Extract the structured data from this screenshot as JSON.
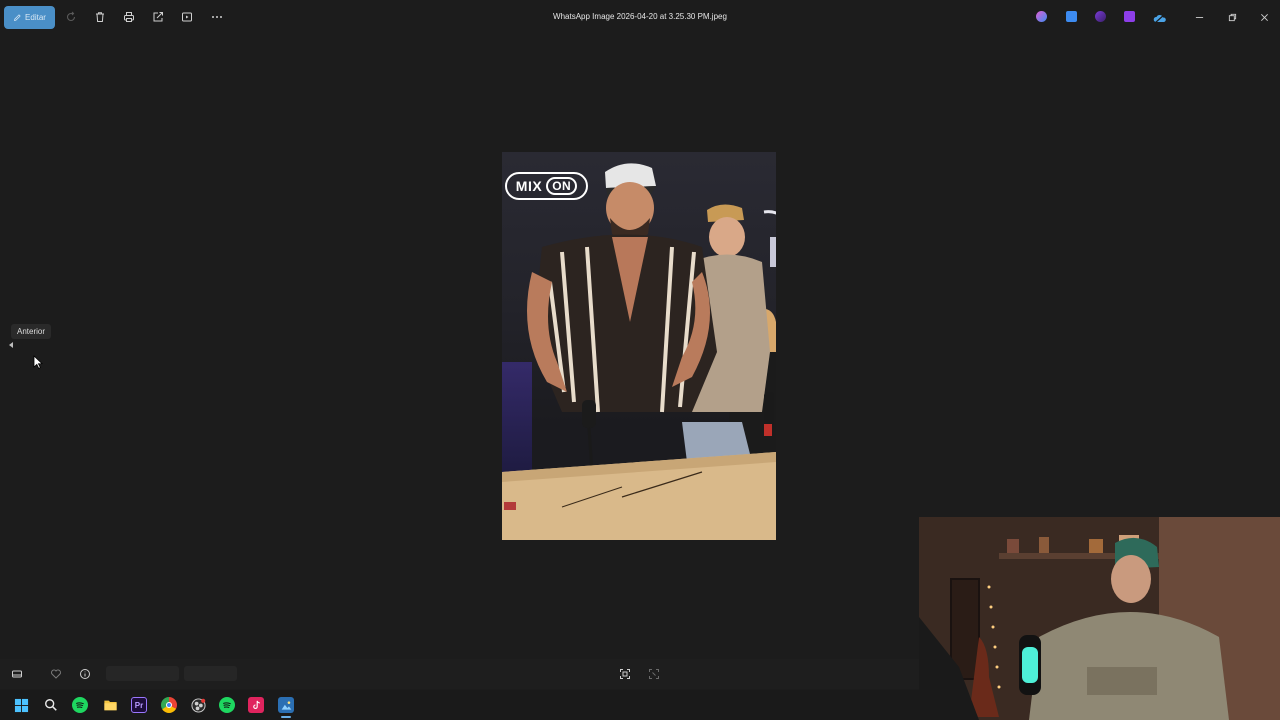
{
  "titlebar": {
    "edit_label": "Editar",
    "window_title": "WhatsApp Image 2026-04-20 at 3.25.30 PM.jpeg",
    "tools": [
      "rotate-icon",
      "delete-icon",
      "print-icon",
      "share-icon",
      "slideshow-icon",
      "more-icon"
    ],
    "app_icons": [
      {
        "name": "copilot-icon",
        "color": "#e05fd6"
      },
      {
        "name": "designer-icon",
        "color": "#3d8bf0"
      },
      {
        "name": "clipchamp-icon",
        "color": "#7a3bd6"
      },
      {
        "name": "film-icon",
        "color": "#8d3ee8"
      },
      {
        "name": "onedrive-icon",
        "color": "#4aa3e6"
      }
    ]
  },
  "photo": {
    "logo_left": "MIX",
    "logo_right": "ON"
  },
  "navigation": {
    "tooltip": "Anterior"
  },
  "taskbar": {
    "premiere_label": "Pr"
  },
  "colors": {
    "background": "#1c1c1c",
    "accent": "#4a8fc7"
  }
}
